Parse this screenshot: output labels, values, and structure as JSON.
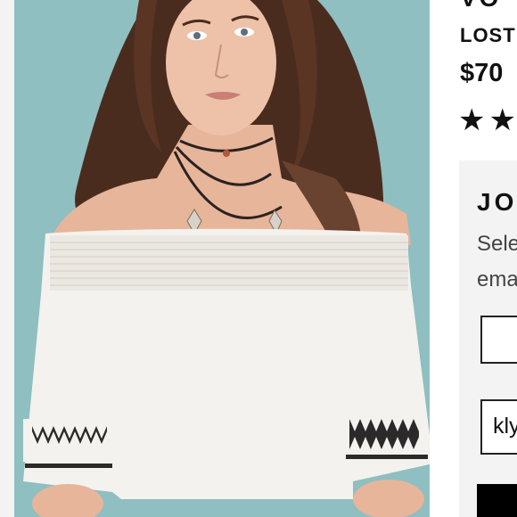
{
  "product": {
    "title_fragment": "VO",
    "brand": "LOST",
    "price": "$70",
    "rating_stars": "★★",
    "rating_value": 2
  },
  "notify_panel": {
    "title": "JO",
    "text_line1": "Sele",
    "text_line2": "ema",
    "email_value": "kly"
  },
  "colors": {
    "photo_background": "#8fbfc0",
    "panel_background": "#f3f3f3",
    "cta_background": "#000000"
  }
}
